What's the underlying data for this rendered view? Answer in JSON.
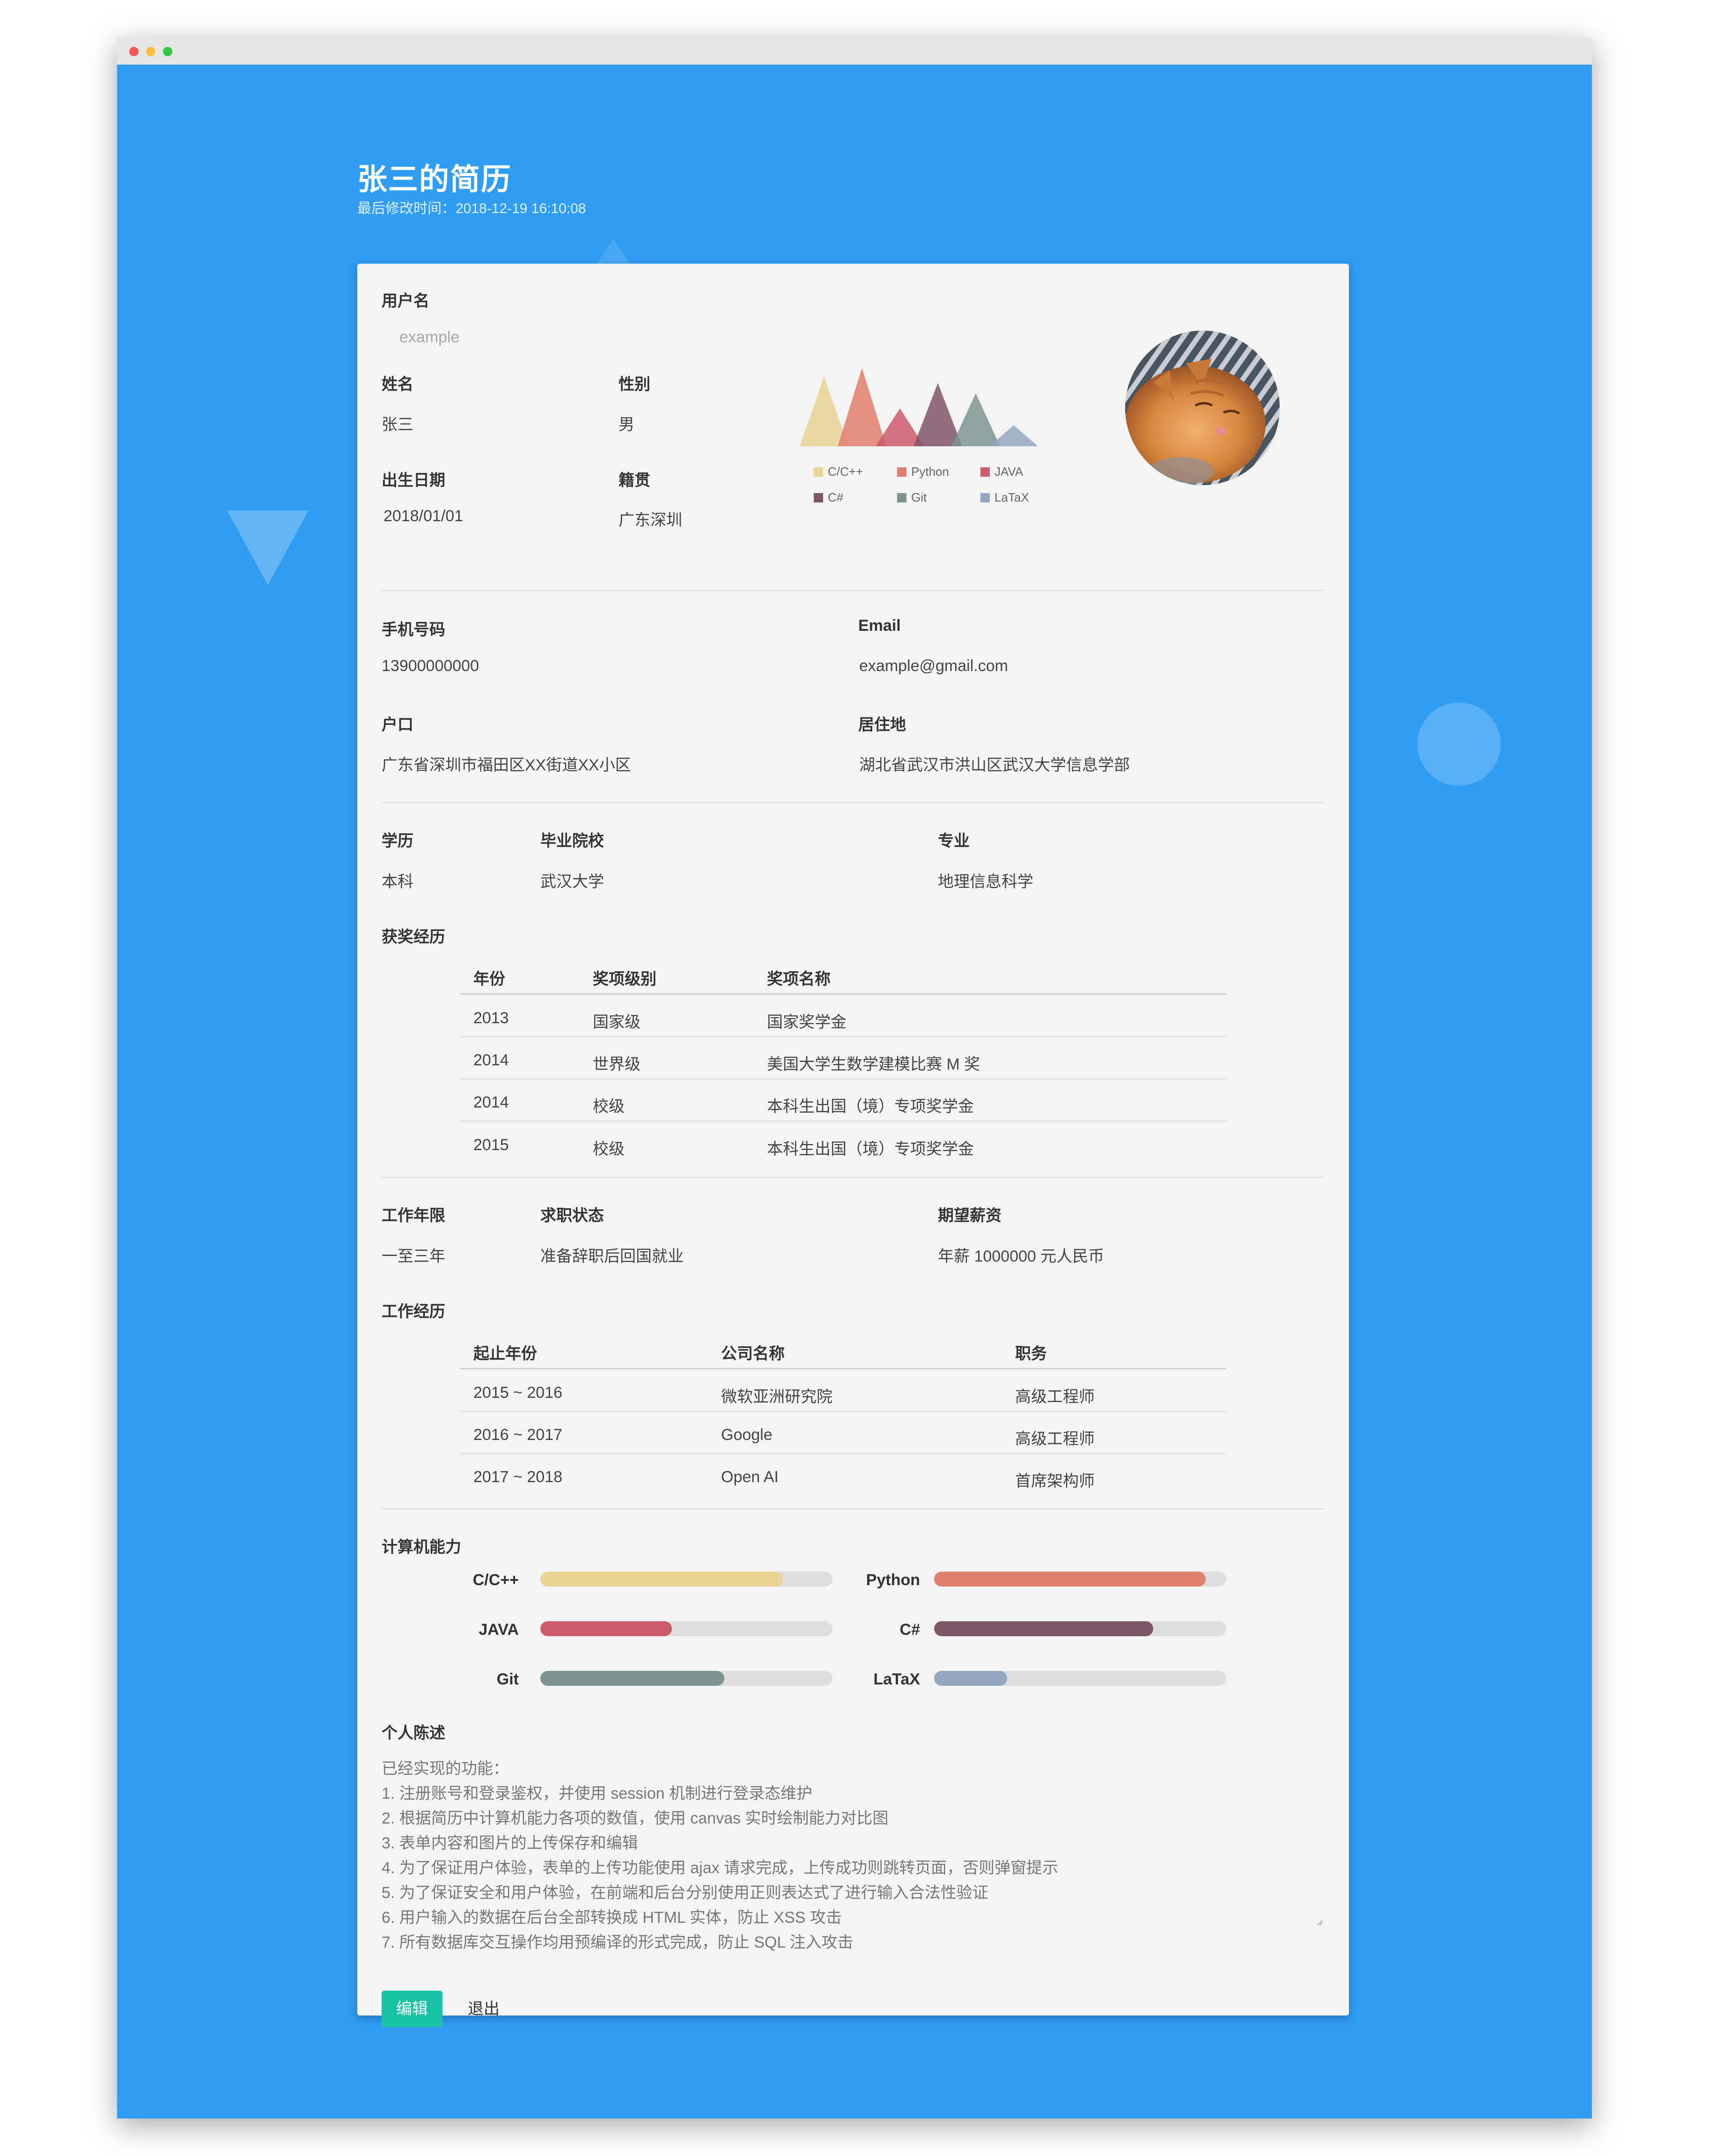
{
  "page": {
    "title": "张三的简历",
    "modified": "最后修改时间：2018-12-19 16:10:08"
  },
  "profile": {
    "username_label": "用户名",
    "username_placeholder": "example",
    "name_label": "姓名",
    "name_value": "张三",
    "gender_label": "性别",
    "gender_value": "男",
    "birth_label": "出生日期",
    "birth_value": "2018/01/01",
    "origin_label": "籍贯",
    "origin_value": "广东深圳"
  },
  "contact": {
    "phone_label": "手机号码",
    "phone_value": "13900000000",
    "email_label": "Email",
    "email_value": "example@gmail.com",
    "hukou_label": "户口",
    "hukou_value": "广东省深圳市福田区XX街道XX小区",
    "residence_label": "居住地",
    "residence_value": "湖北省武汉市洪山区武汉大学信息学部"
  },
  "education": {
    "degree_label": "学历",
    "degree_value": "本科",
    "school_label": "毕业院校",
    "school_value": "武汉大学",
    "major_label": "专业",
    "major_value": "地理信息科学"
  },
  "awards": {
    "section_label": "获奖经历",
    "headers": [
      "年份",
      "奖项级别",
      "奖项名称"
    ],
    "rows": [
      [
        "2013",
        "国家级",
        "国家奖学金"
      ],
      [
        "2014",
        "世界级",
        "美国大学生数学建模比赛 M 奖"
      ],
      [
        "2014",
        "校级",
        "本科生出国（境）专项奖学金"
      ],
      [
        "2015",
        "校级",
        "本科生出国（境）专项奖学金"
      ]
    ]
  },
  "job": {
    "years_label": "工作年限",
    "years_value": "一至三年",
    "status_label": "求职状态",
    "status_value": "准备辞职后回国就业",
    "salary_label": "期望薪资",
    "salary_value": "年薪 1000000 元人民币"
  },
  "experience": {
    "section_label": "工作经历",
    "headers": [
      "起止年份",
      "公司名称",
      "职务"
    ],
    "rows": [
      [
        "2015 ~ 2016",
        "微软亚洲研究院",
        "高级工程师"
      ],
      [
        "2016 ~ 2017",
        "Google",
        "高级工程师"
      ],
      [
        "2017 ~ 2018",
        "Open AI",
        "首席架构师"
      ]
    ]
  },
  "skills_section_label": "计算机能力",
  "chart_data": {
    "type": "area",
    "legend_position": "bottom",
    "series": [
      {
        "name": "C/C++",
        "value": 0.83,
        "color": "#e9d495"
      },
      {
        "name": "Python",
        "value": 0.93,
        "color": "#e07f6d"
      },
      {
        "name": "JAVA",
        "value": 0.45,
        "color": "#cc5c6b"
      },
      {
        "name": "C#",
        "value": 0.75,
        "color": "#7f5568"
      },
      {
        "name": "Git",
        "value": 0.63,
        "color": "#7c9593"
      },
      {
        "name": "LaTaX",
        "value": 0.25,
        "color": "#93a8c0"
      }
    ]
  },
  "statement": {
    "label": "个人陈述",
    "text": "已经实现的功能：\n1. 注册账号和登录鉴权，并使用 session 机制进行登录态维护\n2. 根据简历中计算机能力各项的数值，使用 canvas 实时绘制能力对比图\n3. 表单内容和图片的上传保存和编辑\n4. 为了保证用户体验，表单的上传功能使用 ajax 请求完成，上传成功则跳转页面，否则弹窗提示\n5. 为了保证安全和用户体验，在前端和后台分别使用正则表达式了进行输入合法性验证\n6. 用户输入的数据在后台全部转换成 HTML 实体，防止 XSS 攻击\n7. 所有数据库交互操作均用预编译的形式完成，防止 SQL 注入攻击"
  },
  "buttons": {
    "edit": "编辑",
    "exit": "退出"
  }
}
